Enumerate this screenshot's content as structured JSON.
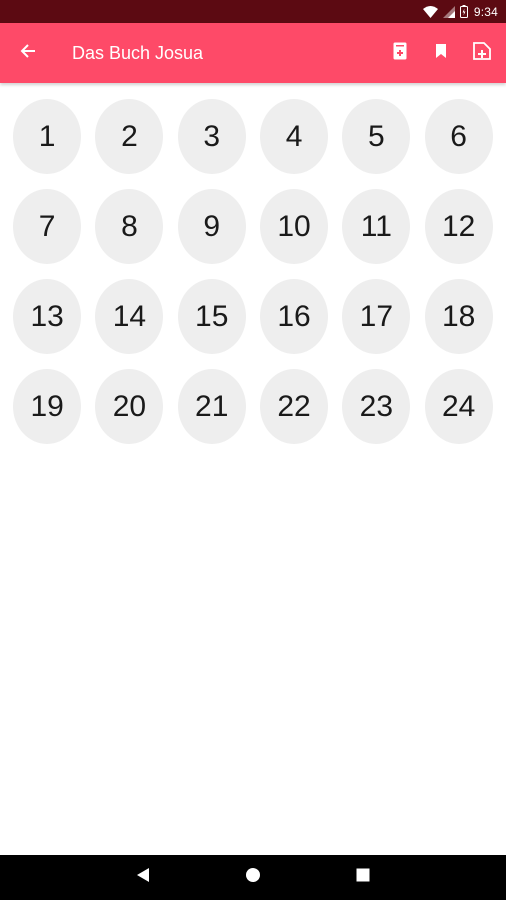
{
  "status_bar": {
    "time": "9:34",
    "icons": [
      "wifi-icon",
      "signal-icon",
      "battery-icon"
    ]
  },
  "app_bar": {
    "title": "Das Buch Josua",
    "back_icon": "arrow-left-icon",
    "actions": [
      "add-to-phone-icon",
      "bookmark-icon",
      "image-add-icon"
    ]
  },
  "chapters": [
    "1",
    "2",
    "3",
    "4",
    "5",
    "6",
    "7",
    "8",
    "9",
    "10",
    "11",
    "12",
    "13",
    "14",
    "15",
    "16",
    "17",
    "18",
    "19",
    "20",
    "21",
    "22",
    "23",
    "24"
  ],
  "nav_bar": {
    "icons": [
      "back-triangle-icon",
      "home-circle-icon",
      "recents-square-icon"
    ]
  },
  "colors": {
    "app_bar": "#fe4a68",
    "status_bar": "#5c0a12",
    "chapter_circle": "#eeeeee"
  }
}
